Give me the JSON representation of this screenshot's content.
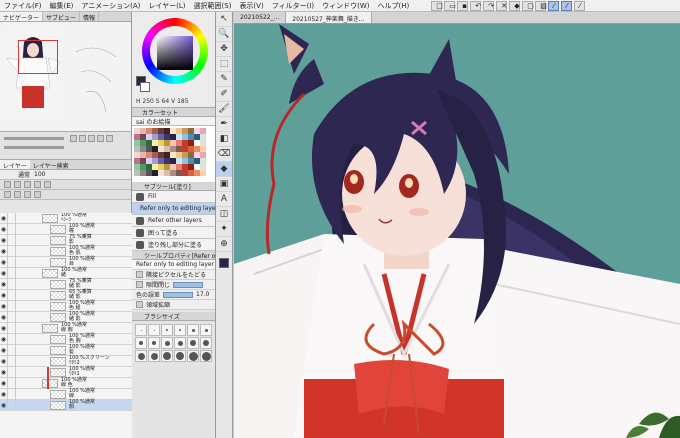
{
  "menu": [
    "ファイル(F)",
    "編集(E)",
    "アニメーション(A)",
    "レイヤー(L)",
    "選択範囲(S)",
    "表示(V)",
    "フィルター(I)",
    "ウィンドウ(W)",
    "ヘルプ(H)"
  ],
  "left_tabs": [
    "ナビゲーター",
    "サブビュー",
    "情報"
  ],
  "layer_tabs": [
    "レイヤー",
    "レイヤー検索"
  ],
  "blend_mode": "通常",
  "opacity_value": "100",
  "layers": [
    {
      "mode": "100 %通常",
      "name": "ﾍｼｰﾗ"
    },
    {
      "mode": "100 %通常",
      "name": "瞳"
    },
    {
      "mode": "75 %乗算",
      "name": "影"
    },
    {
      "mode": "100 %通常",
      "name": "色 肌"
    },
    {
      "mode": "100 %通常",
      "name": "目"
    },
    {
      "mode": "100 %通常",
      "name": "緒"
    },
    {
      "mode": "75 %乗算",
      "name": "緒 影"
    },
    {
      "mode": "65 %乗算",
      "name": "緒 影"
    },
    {
      "mode": "100 %通常",
      "name": "色 紐"
    },
    {
      "mode": "100 %通常",
      "name": "緒 影"
    },
    {
      "mode": "100 %通常",
      "name": "線 腕"
    },
    {
      "mode": "100 %通常",
      "name": "色 腕"
    },
    {
      "mode": "100 %通常",
      "name": "髪"
    },
    {
      "mode": "100 %スクリーン",
      "name": "ﾜﾀﾘ2"
    },
    {
      "mode": "100 %通常",
      "name": "ﾜﾀﾘ1"
    },
    {
      "mode": "100 %通常",
      "name": "線 色"
    },
    {
      "mode": "100 %通常",
      "name": "線"
    },
    {
      "mode": "100 %通常",
      "name": "顔"
    }
  ],
  "color": {
    "h": "250",
    "s": "64",
    "v": "185",
    "main": "#2b2346",
    "sub": "#ffffff"
  },
  "palette_title": "カラーセット",
  "palette_name": "sai のお絵描",
  "subtool_title": "サブツール[塗り]",
  "subtools": [
    "Fill",
    "Refer only to editing layer",
    "Refer other layers",
    "囲って塗る",
    "塗り残し部分に塗る"
  ],
  "props_title": "ツールプロパティ[Refer only to editing layer]",
  "props_subtitle": "Refer only to editing layer",
  "props": [
    {
      "label": "隣接ピクセルをたどる"
    },
    {
      "label": "隙間閉じ"
    },
    {
      "label": "色の誤差",
      "value": "17.0"
    },
    {
      "label": "領域拡縮"
    }
  ],
  "brush_title": "ブラシサイズ",
  "canvas_tabs": [
    "20210522_...",
    "20210527_神楽舞_描き..."
  ],
  "tools": [
    "↖",
    "🔍",
    "✥",
    "⬚",
    "✎",
    "✐",
    "🖌",
    "✒",
    "◧",
    "⌫",
    "◆",
    "▣",
    "A",
    "◫",
    "✦",
    "⊕"
  ]
}
